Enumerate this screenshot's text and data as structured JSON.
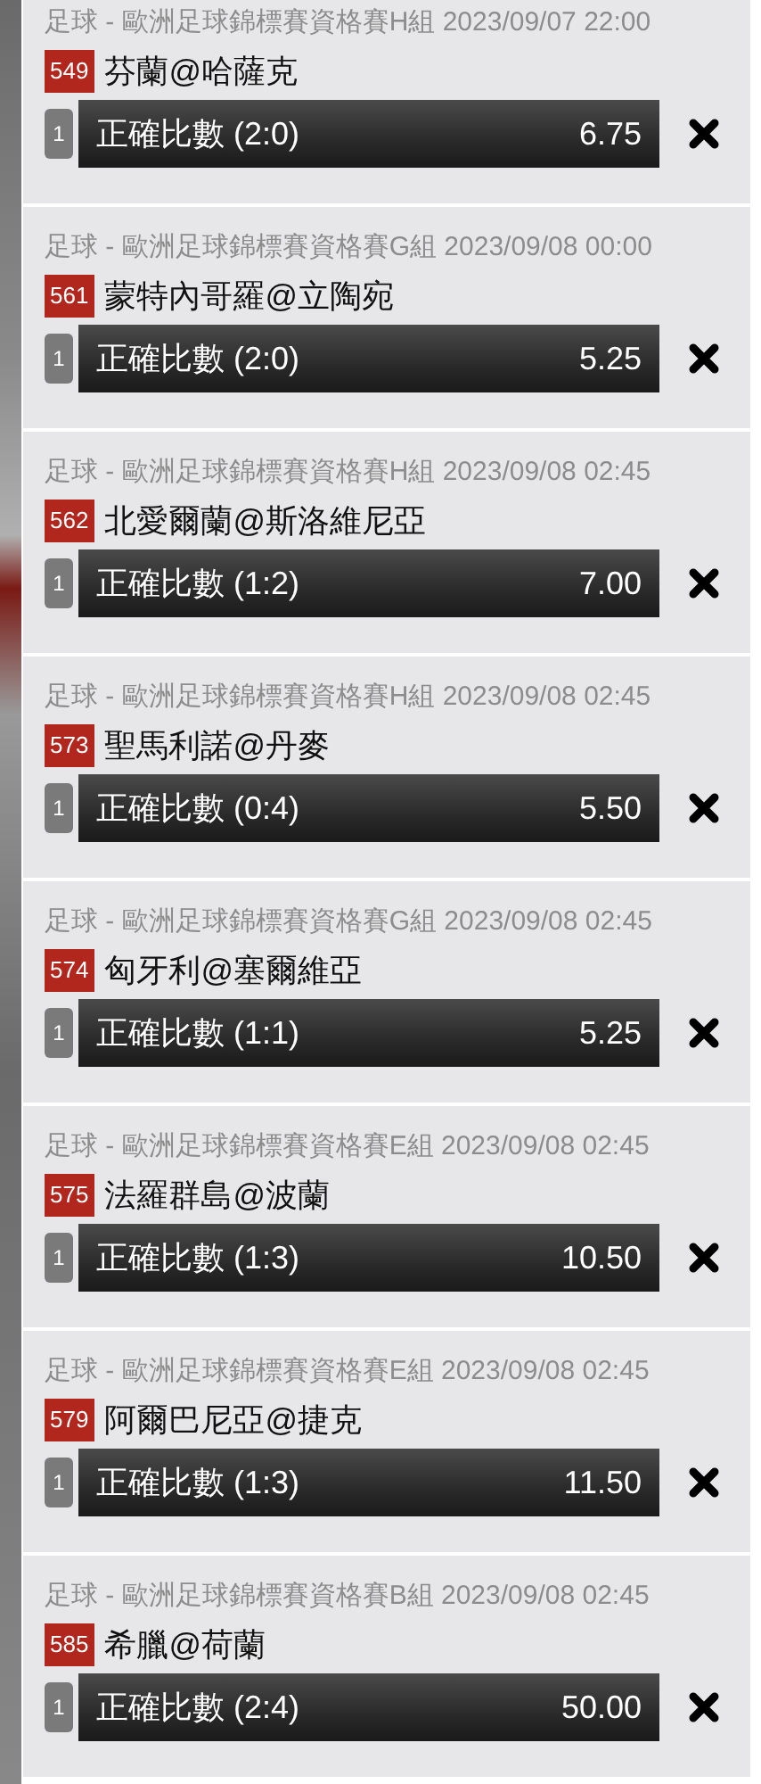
{
  "bets": [
    {
      "league": "足球 - 歐洲足球錦標賽資格賽H組 2023/09/07 22:00",
      "match_no": "549",
      "match": "芬蘭@哈薩克",
      "line": "1",
      "selection": "正確比數 (2:0)",
      "odds": "6.75"
    },
    {
      "league": "足球 - 歐洲足球錦標賽資格賽G組 2023/09/08 00:00",
      "match_no": "561",
      "match": "蒙特內哥羅@立陶宛",
      "line": "1",
      "selection": "正確比數 (2:0)",
      "odds": "5.25"
    },
    {
      "league": "足球 - 歐洲足球錦標賽資格賽H組 2023/09/08 02:45",
      "match_no": "562",
      "match": "北愛爾蘭@斯洛維尼亞",
      "line": "1",
      "selection": "正確比數 (1:2)",
      "odds": "7.00"
    },
    {
      "league": "足球 - 歐洲足球錦標賽資格賽H組 2023/09/08 02:45",
      "match_no": "573",
      "match": "聖馬利諾@丹麥",
      "line": "1",
      "selection": "正確比數 (0:4)",
      "odds": "5.50"
    },
    {
      "league": "足球 - 歐洲足球錦標賽資格賽G組 2023/09/08 02:45",
      "match_no": "574",
      "match": "匈牙利@塞爾維亞",
      "line": "1",
      "selection": "正確比數 (1:1)",
      "odds": "5.25"
    },
    {
      "league": "足球 - 歐洲足球錦標賽資格賽E組 2023/09/08 02:45",
      "match_no": "575",
      "match": "法羅群島@波蘭",
      "line": "1",
      "selection": "正確比數 (1:3)",
      "odds": "10.50"
    },
    {
      "league": "足球 - 歐洲足球錦標賽資格賽E組 2023/09/08 02:45",
      "match_no": "579",
      "match": "阿爾巴尼亞@捷克",
      "line": "1",
      "selection": "正確比數 (1:3)",
      "odds": "11.50"
    },
    {
      "league": "足球 - 歐洲足球錦標賽資格賽B組 2023/09/08 02:45",
      "match_no": "585",
      "match": "希臘@荷蘭",
      "line": "1",
      "selection": "正確比數 (2:4)",
      "odds": "50.00"
    }
  ]
}
